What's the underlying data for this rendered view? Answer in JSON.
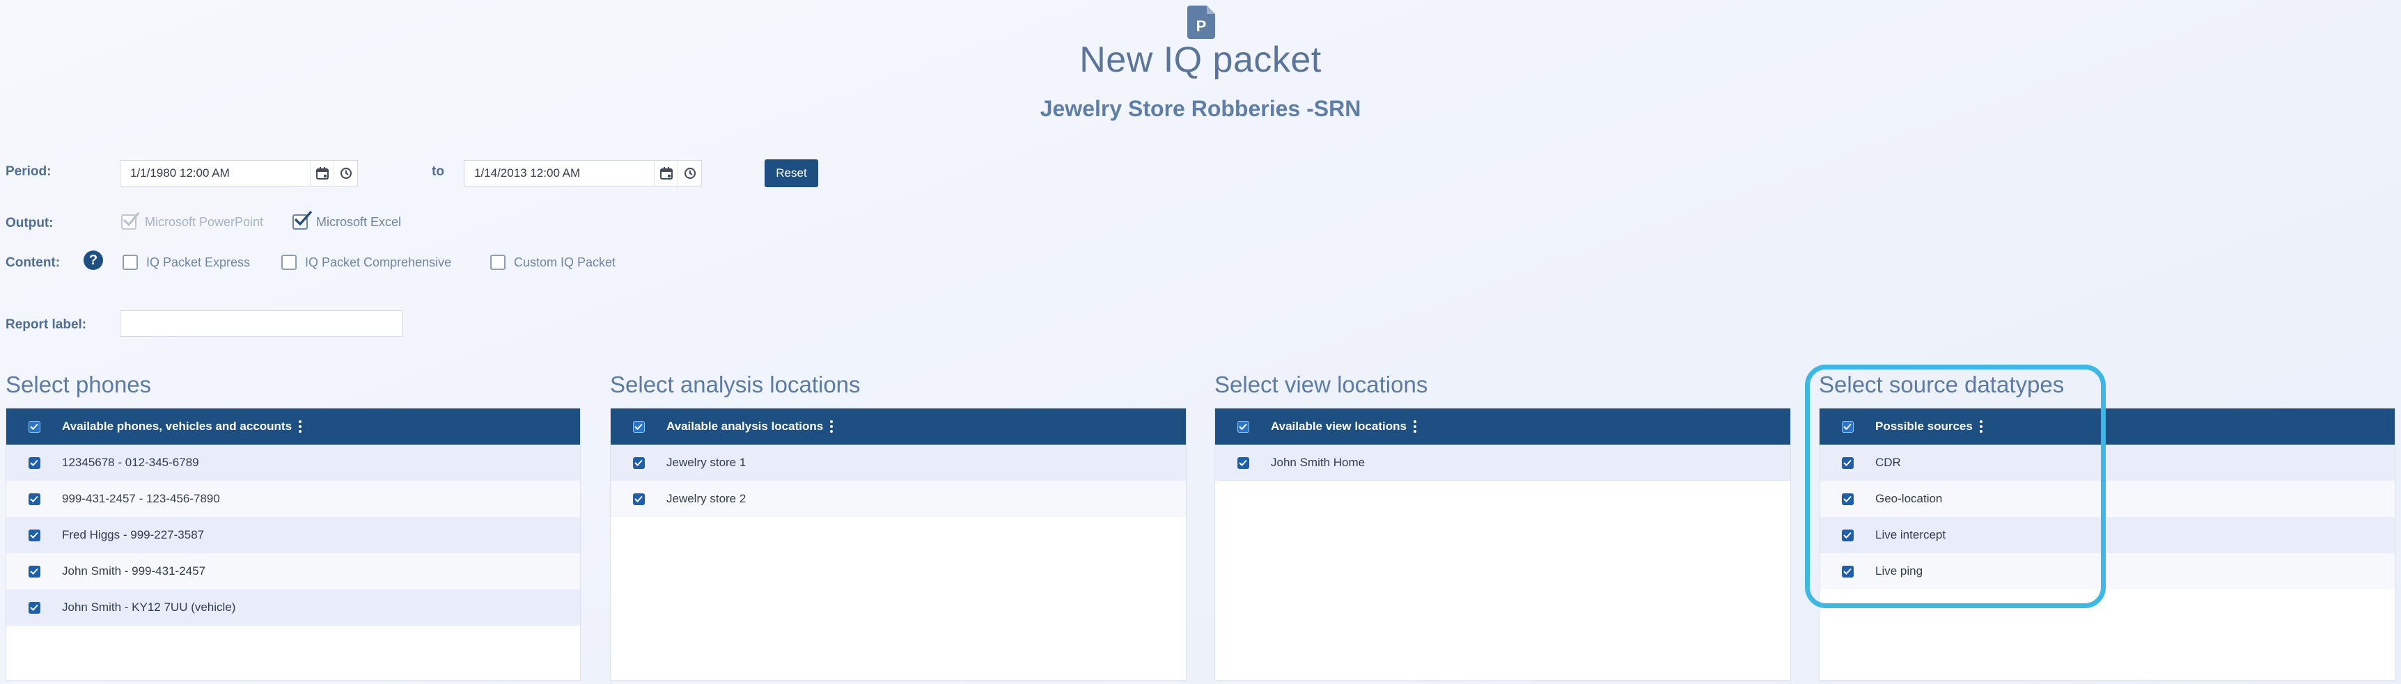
{
  "header": {
    "icon_letter": "P",
    "title": "New IQ packet",
    "packet_name": "Jewelry Store Robberies -SRN"
  },
  "period": {
    "label": "Period:",
    "from": "1/1/1980 12:00 AM",
    "to_label": "to",
    "to": "1/14/2013 12:00 AM",
    "reset_label": "Reset"
  },
  "output": {
    "label": "Output:",
    "options": [
      {
        "label": "Microsoft PowerPoint",
        "checked": true,
        "disabled": true
      },
      {
        "label": "Microsoft Excel",
        "checked": true,
        "disabled": false
      }
    ]
  },
  "content": {
    "label": "Content:",
    "help": "?",
    "options": [
      {
        "label": "IQ Packet Express",
        "checked": false
      },
      {
        "label": "IQ Packet Comprehensive",
        "checked": false
      },
      {
        "label": "Custom IQ Packet",
        "checked": false
      }
    ]
  },
  "report": {
    "label": "Report label:",
    "value": ""
  },
  "panels": [
    {
      "title": "Select phones",
      "header": "Available phones, vehicles and accounts",
      "rows": [
        "12345678 - 012-345-6789",
        "999-431-2457 - 123-456-7890",
        "Fred Higgs - 999-227-3587",
        "John Smith - 999-431-2457",
        "John Smith - KY12 7UU (vehicle)"
      ]
    },
    {
      "title": "Select analysis locations",
      "header": "Available analysis locations",
      "rows": [
        "Jewelry store 1",
        "Jewelry store 2"
      ]
    },
    {
      "title": "Select view locations",
      "header": "Available view locations",
      "rows": [
        "John Smith Home"
      ]
    },
    {
      "title": "Select source datatypes",
      "header": "Possible sources",
      "rows": [
        "CDR",
        "Geo-location",
        "Live intercept",
        "Live ping"
      ]
    }
  ],
  "colors": {
    "primary": "#1d4f82",
    "checkbox": "#1d5fa8",
    "highlight": "#3db7e4",
    "label": "#4f6d95"
  }
}
